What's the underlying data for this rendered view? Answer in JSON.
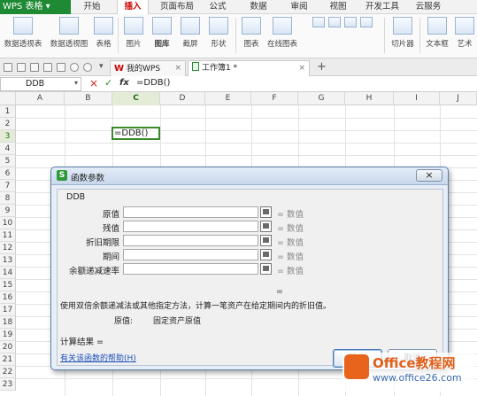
{
  "app": {
    "name": "WPS 表格"
  },
  "menu": [
    "开始",
    "插入",
    "页面布局",
    "公式",
    "数据",
    "审阅",
    "视图",
    "开发工具",
    "云服务"
  ],
  "ribbon": [
    "数据透视表",
    "数据透视图",
    "表格",
    "图片",
    "图库",
    "截屏",
    "形状",
    "图表",
    "在线图表",
    "切片器",
    "文本框",
    "艺术"
  ],
  "tabs": {
    "tab1": "我的WPS",
    "tab2": "工作簿1 *",
    "add": "+"
  },
  "formula_bar": {
    "name_box": "DDB",
    "cancel": "×",
    "confirm": "✓",
    "fx": "fx",
    "content": "=DDB()"
  },
  "columns": [
    "A",
    "B",
    "C",
    "D",
    "E",
    "F",
    "G",
    "H",
    "I",
    "J"
  ],
  "rows": [
    "1",
    "2",
    "3",
    "4",
    "5",
    "6",
    "7",
    "8",
    "9",
    "10",
    "11",
    "12",
    "13",
    "14",
    "15",
    "16",
    "17",
    "18",
    "19",
    "20",
    "21",
    "22",
    "23"
  ],
  "active_cell": {
    "text": "=DDB()"
  },
  "dialog": {
    "title": "函数参数",
    "function_name": "DDB",
    "args": [
      {
        "label": "原值",
        "result": "= 数值"
      },
      {
        "label": "残值",
        "result": "= 数值"
      },
      {
        "label": "折旧期限",
        "result": "= 数值"
      },
      {
        "label": "期间",
        "result": "= 数值"
      },
      {
        "label": "余额递减速率",
        "result": "= 数值"
      }
    ],
    "formula_result_eq": "=",
    "description": "使用双倍余额递减法或其他指定方法，计算一笔资产在给定期间内的折旧值。",
    "param_name": "原值:",
    "param_desc": "固定资产原值",
    "calc_result": "计算结果 =",
    "help_link": "有关该函数的帮助(H)",
    "ok": "确定",
    "cancel": "取消"
  },
  "watermark": {
    "brand": "Office教程网",
    "url": "www.office26.com"
  }
}
